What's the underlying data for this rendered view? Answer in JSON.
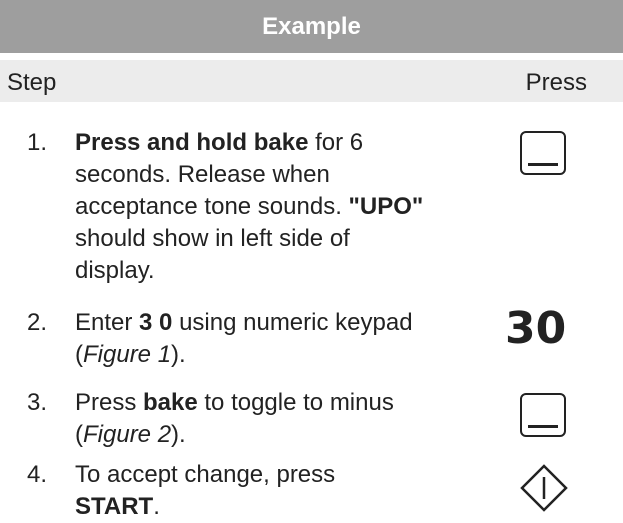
{
  "header": {
    "title": "Example"
  },
  "columns": {
    "step": "Step",
    "press": "Press"
  },
  "steps": [
    {
      "number": "1.",
      "parts": [
        {
          "t": "Press and hold bake",
          "s": "b"
        },
        {
          "t": " for 6 seconds. Release when acceptance tone sounds. ",
          "s": ""
        },
        {
          "t": "\"UPO\"",
          "s": "b"
        },
        {
          "t": " should show in left side of display.",
          "s": ""
        }
      ],
      "press": {
        "type": "icon",
        "icon": "bake-button-icon"
      }
    },
    {
      "number": "2.",
      "parts": [
        {
          "t": "Enter ",
          "s": ""
        },
        {
          "t": "3 0",
          "s": "b"
        },
        {
          "t": " using numeric keypad (",
          "s": ""
        },
        {
          "t": "Figure 1",
          "s": "i"
        },
        {
          "t": ").",
          "s": ""
        }
      ],
      "press": {
        "type": "text",
        "text": "30"
      }
    },
    {
      "number": "3.",
      "parts": [
        {
          "t": "Press ",
          "s": ""
        },
        {
          "t": "bake",
          "s": "b"
        },
        {
          "t": " to toggle to minus (",
          "s": ""
        },
        {
          "t": "Figure 2",
          "s": "i"
        },
        {
          "t": ").",
          "s": ""
        }
      ],
      "press": {
        "type": "icon",
        "icon": "bake-button-icon"
      }
    },
    {
      "number": "4.",
      "parts": [
        {
          "t": "To accept change, press ",
          "s": ""
        },
        {
          "t": "START",
          "s": "b"
        },
        {
          "t": ".",
          "s": ""
        }
      ],
      "press": {
        "type": "icon",
        "icon": "start-icon"
      }
    }
  ]
}
